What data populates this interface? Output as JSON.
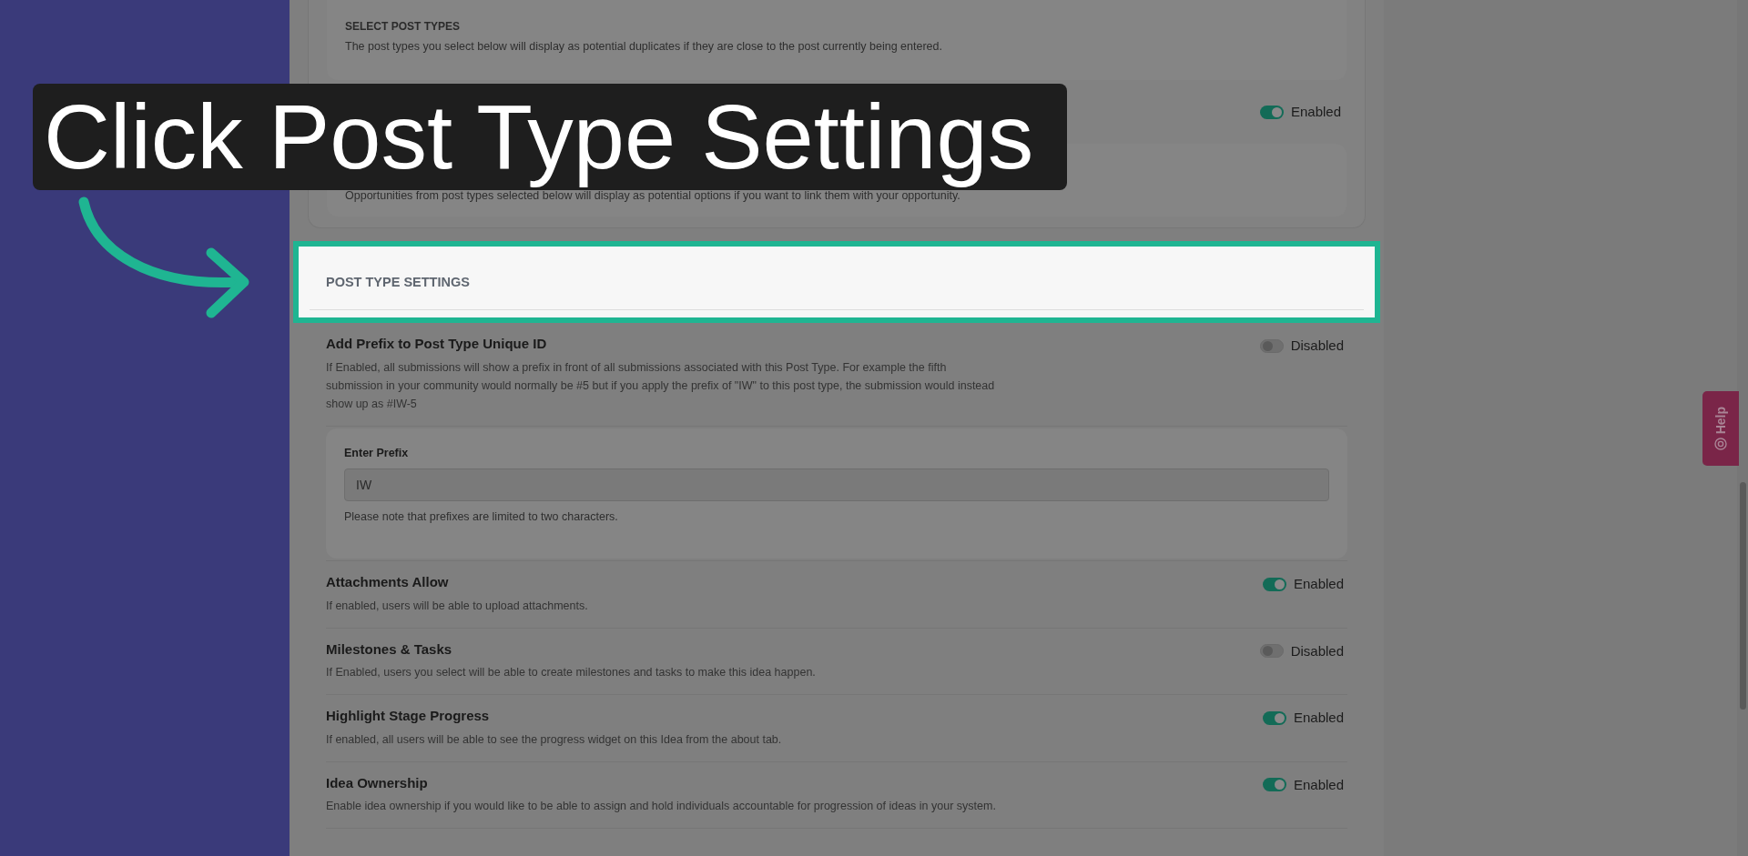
{
  "overlay": {
    "title": "Click Post Type Settings"
  },
  "duplicates_panel": {
    "heading": "SELECT POST TYPES",
    "description": "The post types you select below will display as potential duplicates if they are close to the post currently being entered."
  },
  "linking": {
    "on": true,
    "status": "Enabled"
  },
  "linking_panel": {
    "description": "Opportunities from post types selected below will display as potential options if you want to link them with your opportunity."
  },
  "section": {
    "title": "POST TYPE SETTINGS"
  },
  "settings": [
    {
      "kind": "toggle",
      "title": "Add Prefix to Post Type Unique ID",
      "description": "If Enabled, all submissions will show a prefix in front of all submissions associated with this Post Type. For example the fifth submission in your community would normally be #5 but if you apply the prefix of \"IW\" to this post type, the submission would instead show up as #IW-5",
      "on": false,
      "status": "Disabled"
    },
    {
      "kind": "prefix_panel",
      "label": "Enter Prefix",
      "placeholder": "IW",
      "note": "Please note that prefixes are limited to two characters."
    },
    {
      "kind": "toggle",
      "title": "Attachments Allow",
      "description": "If enabled, users will be able to upload attachments.",
      "on": true,
      "status": "Enabled"
    },
    {
      "kind": "toggle",
      "title": "Milestones & Tasks",
      "description": "If Enabled, users you select will be able to create milestones and tasks to make this idea happen.",
      "on": false,
      "status": "Disabled"
    },
    {
      "kind": "toggle",
      "title": "Highlight Stage Progress",
      "description": "If enabled, all users will be able to see the progress widget on this Idea from the about tab.",
      "on": true,
      "status": "Enabled"
    },
    {
      "kind": "toggle",
      "title": "Idea Ownership",
      "description": "Enable idea ownership if you would like to be able to assign and hold individuals accountable for progression of ideas in your system.",
      "on": true,
      "status": "Enabled"
    }
  ],
  "help_tab": {
    "label": "Help"
  }
}
